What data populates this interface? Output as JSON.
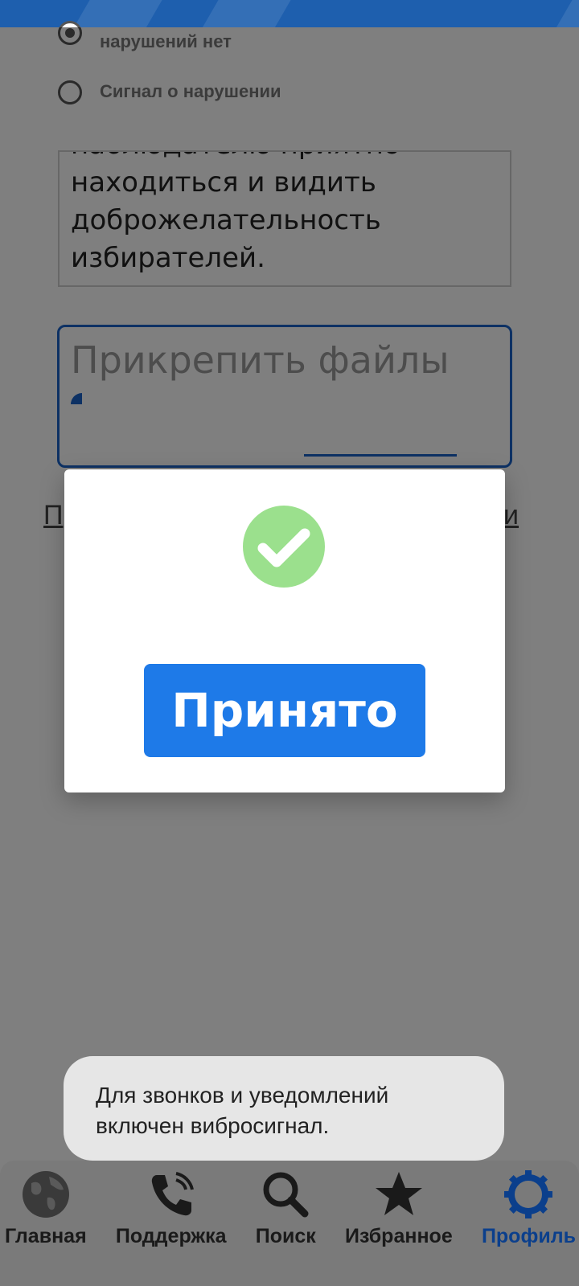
{
  "form": {
    "option_1_line_2": "нарушений нет",
    "option_2": "Сигнал о нарушении",
    "text_partial_line": "наблюдателю приятно",
    "text_lines": [
      "находиться и видить",
      "доброжелательность",
      "избирателей."
    ],
    "attach_placeholder": "Прикрепить файлы",
    "link_left_fragment": "П",
    "link_right_fragment": "и"
  },
  "dialog": {
    "icon": "check-circle-icon",
    "accept_label": "Принято"
  },
  "toast": {
    "line_1": "Для звонков и уведомлений",
    "line_2": "включен вибросигнал."
  },
  "nav": {
    "items": [
      {
        "label": "Главная",
        "icon": "globe-icon",
        "active": false
      },
      {
        "label": "Поддержка",
        "icon": "phone-icon",
        "active": false
      },
      {
        "label": "Поиск",
        "icon": "search-icon",
        "active": false
      },
      {
        "label": "Избранное",
        "icon": "star-icon",
        "active": false
      },
      {
        "label": "Профиль",
        "icon": "gear-icon",
        "active": true
      }
    ]
  },
  "colors": {
    "header": "#1e5fae",
    "accent": "#1e7ae8",
    "success": "#9be08d",
    "active_nav": "#0b3f8c"
  }
}
